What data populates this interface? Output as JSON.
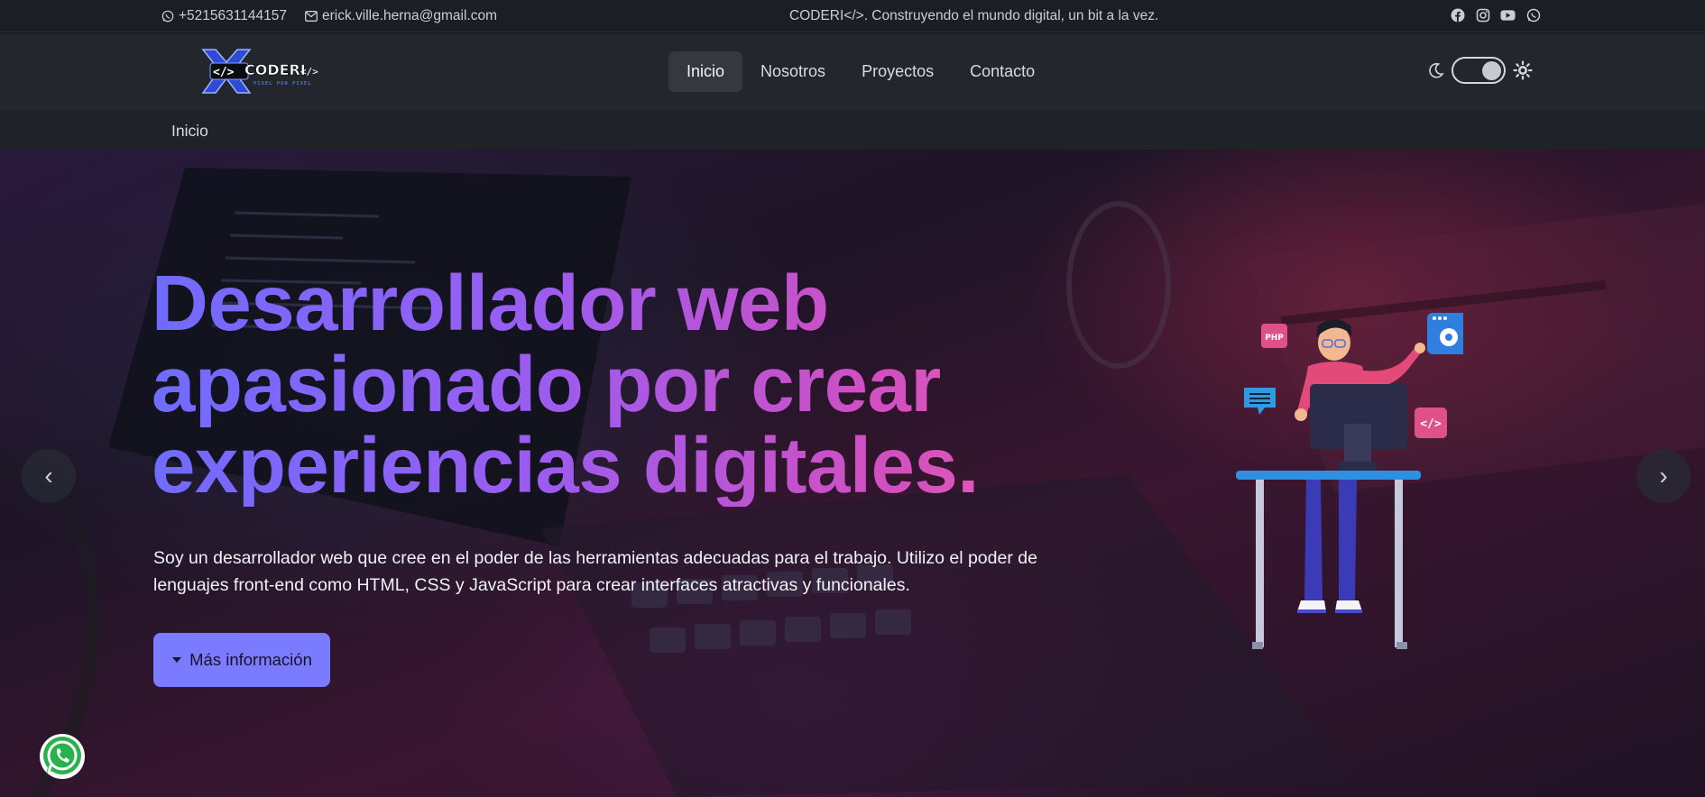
{
  "topbar": {
    "phone": "+5215631144157",
    "email": "erick.ville.herna@gmail.com",
    "tagline": "CODERI</>. Construyendo el mundo digital, un bit a la vez.",
    "social": [
      "facebook-icon",
      "instagram-icon",
      "youtube-icon",
      "whatsapp-icon"
    ]
  },
  "brand": {
    "logo_text": "CODERI</>",
    "logo_subtext": "PIXEL POR PIXEL"
  },
  "nav": {
    "items": [
      {
        "label": "Inicio",
        "active": true
      },
      {
        "label": "Nosotros",
        "active": false
      },
      {
        "label": "Proyectos",
        "active": false
      },
      {
        "label": "Contacto",
        "active": false
      }
    ],
    "theme_toggle": {
      "state": "dark"
    }
  },
  "breadcrumb": {
    "current": "Inicio"
  },
  "hero": {
    "title": "Desarrollador web apasionado por crear experiencias digitales.",
    "description": "Soy un desarrollador web que cree en el poder de las herramientas adecuadas para el trabajo. Utilizo el poder de lenguajes front-end como HTML, CSS y JavaScript para crear interfaces atractivas y funcionales.",
    "cta_label": "Más información",
    "prev_label": "‹",
    "next_label": "›",
    "illustration_tags": [
      "PHP",
      "</>"
    ]
  },
  "colors": {
    "accent": "#7b7bff",
    "gradient_start": "#6f6cff",
    "gradient_end": "#e25ab6",
    "topbar_bg": "#1b1e23",
    "nav_bg": "#23272d"
  }
}
